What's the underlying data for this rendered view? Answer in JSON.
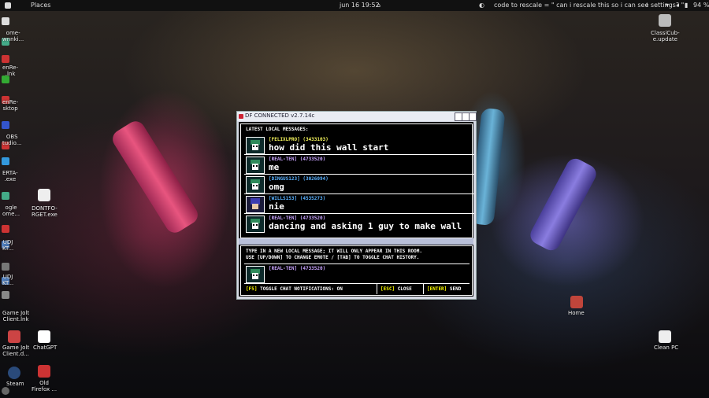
{
  "topbar": {
    "places": "Places",
    "datetime": "jun 16  19:52",
    "notification": "code to rescale = \" can i rescale this so i can see settings? \"",
    "battery": "94 %"
  },
  "desktop": {
    "icons": [
      {
        "label": "Home",
        "color": "#c0453b"
      },
      {
        "label": "Clean PC",
        "color": "#3aa05a"
      },
      {
        "label": "ClassiCub-\ne.update",
        "color": "#888"
      },
      {
        "label": "DONTFO-\nRGET.exe",
        "color": "#ddd"
      },
      {
        "label": "ChatGPT",
        "color": "#fff"
      },
      {
        "label": "Old\nFirefox ...",
        "color": "#c33"
      },
      {
        "label": "Game Jolt\nClient.lnk",
        "color": "#c44"
      },
      {
        "label": "Game Jolt\nClient.d...",
        "color": "#c44"
      },
      {
        "label": "Steam",
        "color": "#2a4a7a"
      }
    ],
    "dock_labels": [
      "ome-\nwnnki...",
      "enRe-\n.lnk",
      "enRe-\nsktop",
      "OBS\ntudio...",
      "ERTA-\n.exe",
      "ogle\nome...",
      "UDJ\nKT...",
      "UDJ\nKT..."
    ]
  },
  "window": {
    "title": "DF CONNECTED v2.7.14c",
    "messages_header": "LATEST LOCAL MESSAGES:",
    "messages": [
      {
        "name": "[FELIXLPRO] (3433103)",
        "name_color": "#f2f25a",
        "text": "how did this wall start",
        "avatar": "ralsei"
      },
      {
        "name": "[REAL-TEN] (4733520)",
        "name_color": "#c9a4ff",
        "text": "me",
        "avatar": "ralsei"
      },
      {
        "name": "[DINGUS123] (3026094)",
        "name_color": "#5ab2ff",
        "text": "omg",
        "avatar": "ralsei"
      },
      {
        "name": "[WILLS153] (4535273)",
        "name_color": "#5ab2ff",
        "text": "nie",
        "avatar": "kris"
      },
      {
        "name": "[REAL-TEN] (4733520)",
        "name_color": "#c9a4ff",
        "text": "dancing and asking 1 guy to make wall",
        "avatar": "ralsei"
      }
    ],
    "instructions_line1": "TYPE IN A NEW LOCAL MESSAGE; IT WILL ONLY APPEAR IN THIS ROOM.",
    "instructions_line2": "USE [UP/DOWN] TO CHANGE EMOTE / [TAB] TO TOGGLE CHAT HISTORY.",
    "input_name": "[REAL-TEN] (4733520)",
    "footer": {
      "notif_key": "[F5]",
      "notif_label": "TOGGLE CHAT NOTIFICATIONS: ON",
      "close_key": "[ESC]",
      "close_label": "CLOSE",
      "send_key": "[ENTER]",
      "send_label": "SEND"
    }
  }
}
